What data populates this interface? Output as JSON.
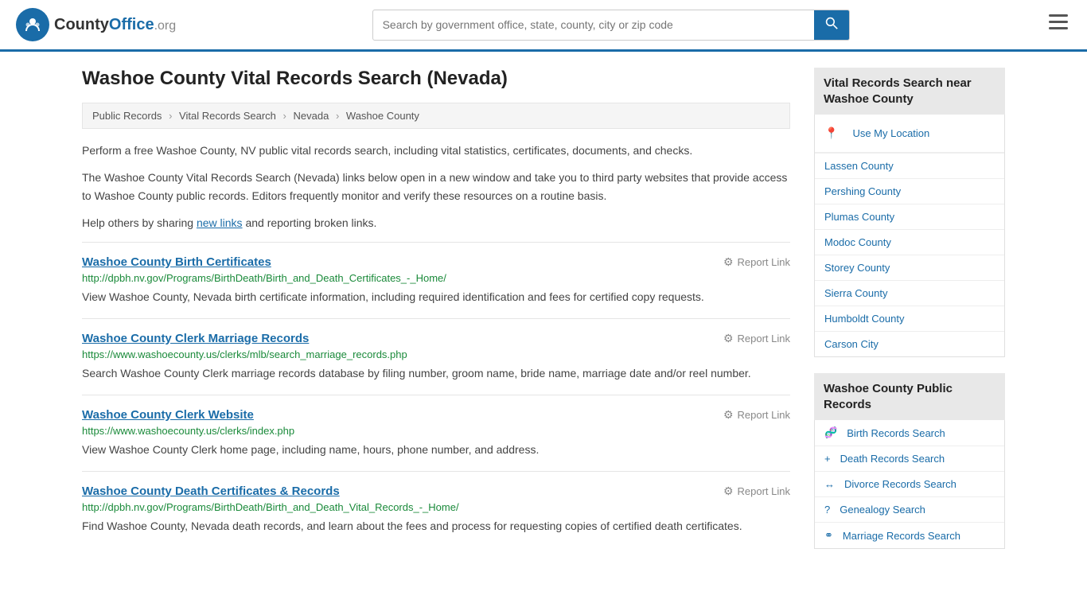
{
  "header": {
    "logo_text": "CountyOffice",
    "logo_org": ".org",
    "search_placeholder": "Search by government office, state, county, city or zip code"
  },
  "page": {
    "title": "Washoe County Vital Records Search (Nevada)",
    "breadcrumb": [
      {
        "label": "Public Records",
        "href": "#"
      },
      {
        "label": "Vital Records Search",
        "href": "#"
      },
      {
        "label": "Nevada",
        "href": "#"
      },
      {
        "label": "Washoe County",
        "href": "#"
      }
    ],
    "intro1": "Perform a free Washoe County, NV public vital records search, including vital statistics, certificates, documents, and checks.",
    "intro2": "The Washoe County Vital Records Search (Nevada) links below open in a new window and take you to third party websites that provide access to Washoe County public records. Editors frequently monitor and verify these resources on a routine basis.",
    "intro3_prefix": "Help others by sharing ",
    "intro3_link": "new links",
    "intro3_suffix": " and reporting broken links.",
    "records": [
      {
        "title": "Washoe County Birth Certificates",
        "url": "http://dpbh.nv.gov/Programs/BirthDeath/Birth_and_Death_Certificates_-_Home/",
        "description": "View Washoe County, Nevada birth certificate information, including required identification and fees for certified copy requests.",
        "report_label": "Report Link"
      },
      {
        "title": "Washoe County Clerk Marriage Records",
        "url": "https://www.washoecounty.us/clerks/mlb/search_marriage_records.php",
        "description": "Search Washoe County Clerk marriage records database by filing number, groom name, bride name, marriage date and/or reel number.",
        "report_label": "Report Link"
      },
      {
        "title": "Washoe County Clerk Website",
        "url": "https://www.washoecounty.us/clerks/index.php",
        "description": "View Washoe County Clerk home page, including name, hours, phone number, and address.",
        "report_label": "Report Link"
      },
      {
        "title": "Washoe County Death Certificates & Records",
        "url": "http://dpbh.nv.gov/Programs/BirthDeath/Birth_and_Death_Vital_Records_-_Home/",
        "description": "Find Washoe County, Nevada death records, and learn about the fees and process for requesting copies of certified death certificates.",
        "report_label": "Report Link"
      }
    ]
  },
  "sidebar": {
    "nearby_heading": "Vital Records Search near Washoe County",
    "use_location_label": "Use My Location",
    "nearby_links": [
      {
        "label": "Lassen County"
      },
      {
        "label": "Pershing County"
      },
      {
        "label": "Plumas County"
      },
      {
        "label": "Modoc County"
      },
      {
        "label": "Storey County"
      },
      {
        "label": "Sierra County"
      },
      {
        "label": "Humboldt County"
      },
      {
        "label": "Carson City"
      }
    ],
    "public_records_heading": "Washoe County Public Records",
    "public_records_links": [
      {
        "icon": "🧬",
        "label": "Birth Records Search"
      },
      {
        "icon": "+",
        "label": "Death Records Search"
      },
      {
        "icon": "↔",
        "label": "Divorce Records Search"
      },
      {
        "icon": "?",
        "label": "Genealogy Search"
      },
      {
        "icon": "⚭",
        "label": "Marriage Records Search"
      }
    ]
  }
}
